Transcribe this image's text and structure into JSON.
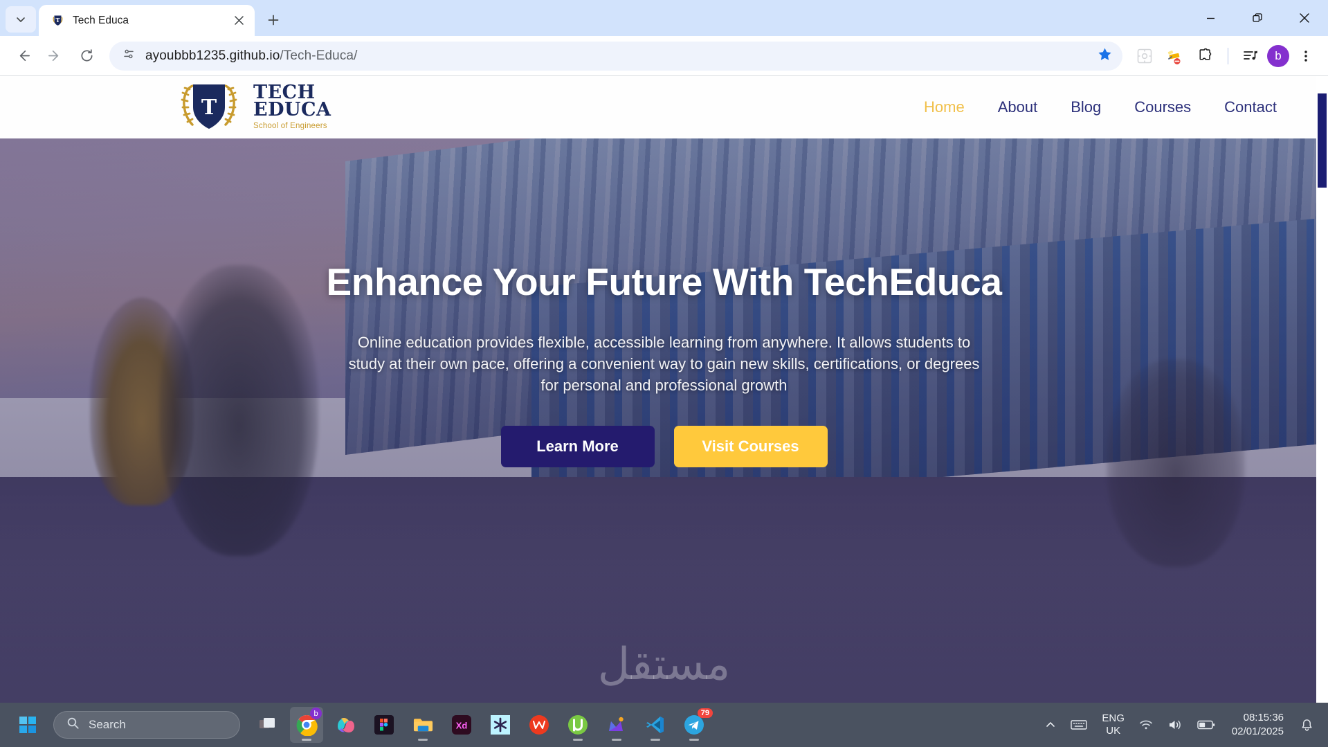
{
  "browser": {
    "tab": {
      "title": "Tech Educa",
      "favicon_icon": "shield-favicon"
    },
    "tab_search_icon": "chevron-down-icon",
    "new_tab_icon": "plus-icon",
    "window_controls": {
      "minimize_icon": "minimize-icon",
      "restore_icon": "restore-icon",
      "close_icon": "close-icon"
    },
    "nav": {
      "back_icon": "back-arrow-icon",
      "forward_icon": "forward-arrow-icon",
      "reload_icon": "reload-icon"
    },
    "omnibox": {
      "site_info_icon": "site-settings-icon",
      "url_host": "ayoubbb1235.github.io",
      "url_path": "/Tech-Educa/",
      "bookmark_icon": "star-filled-icon"
    },
    "toolbar_icons": [
      {
        "name": "qr-code-icon",
        "label": ""
      },
      {
        "name": "extension-build-icon",
        "label": ""
      },
      {
        "name": "puzzle-extensions-icon",
        "label": ""
      },
      {
        "name": "media-playlist-icon",
        "label": ""
      }
    ],
    "profile": {
      "initial": "b",
      "color": "#8430ce"
    },
    "menu_icon": "three-dot-menu-icon",
    "scrollbar": {
      "thumb_color": "#1b1d72"
    }
  },
  "site": {
    "logo": {
      "line1": "TECH",
      "line2": "EDUCA",
      "tagline": "School of Engineers",
      "mark_letter": "T",
      "shield_color": "#1b2a5e",
      "laurel_color": "#c89b2e"
    },
    "nav": [
      {
        "label": "Home",
        "active": true
      },
      {
        "label": "About",
        "active": false
      },
      {
        "label": "Blog",
        "active": false
      },
      {
        "label": "Courses",
        "active": false
      },
      {
        "label": "Contact",
        "active": false
      }
    ],
    "nav_active_color": "#f1c04a",
    "nav_color": "#2b2f7a",
    "hero": {
      "heading": "Enhance Your Future With TechEduca",
      "paragraph": "Online education provides flexible, accessible learning from anywhere. It allows students to study at their own pace, offering a convenient way to gain new skills, certifications, or degrees for personal and professional growth",
      "primary_button": {
        "label": "Learn More",
        "color": "#241b6e"
      },
      "secondary_button": {
        "label": "Visit Courses",
        "color": "#ffc93c"
      }
    },
    "watermark": "مستقل"
  },
  "taskbar": {
    "start_icon": "windows-start-icon",
    "search": {
      "icon": "search-icon",
      "placeholder": "Search"
    },
    "apps": [
      {
        "name": "task-view-icon",
        "active": false,
        "running": false
      },
      {
        "name": "google-chrome-icon",
        "active": true,
        "running": true
      },
      {
        "name": "microsoft-copilot-icon",
        "active": false,
        "running": false
      },
      {
        "name": "figma-icon",
        "active": false,
        "running": false
      },
      {
        "name": "file-explorer-icon",
        "active": false,
        "running": true
      },
      {
        "name": "adobe-xd-icon",
        "active": false,
        "running": false
      },
      {
        "name": "asterisk-app-icon",
        "active": false,
        "running": false
      },
      {
        "name": "wondershare-icon",
        "active": false,
        "running": false
      },
      {
        "name": "utorrent-icon",
        "active": false,
        "running": true
      },
      {
        "name": "mega-app-icon",
        "active": false,
        "running": true
      },
      {
        "name": "visual-studio-code-icon",
        "active": false,
        "running": true
      },
      {
        "name": "telegram-icon",
        "active": false,
        "running": true,
        "badge": "79"
      }
    ],
    "tray": {
      "overflow_icon": "chevron-up-icon",
      "keyboard_icon": "keyboard-icon",
      "language_line1": "ENG",
      "language_line2": "UK",
      "wifi_icon": "wifi-icon",
      "volume_icon": "volume-icon",
      "battery_icon": "battery-icon",
      "time": "08:15:36",
      "date": "02/01/2025",
      "notifications_icon": "bell-icon"
    }
  }
}
